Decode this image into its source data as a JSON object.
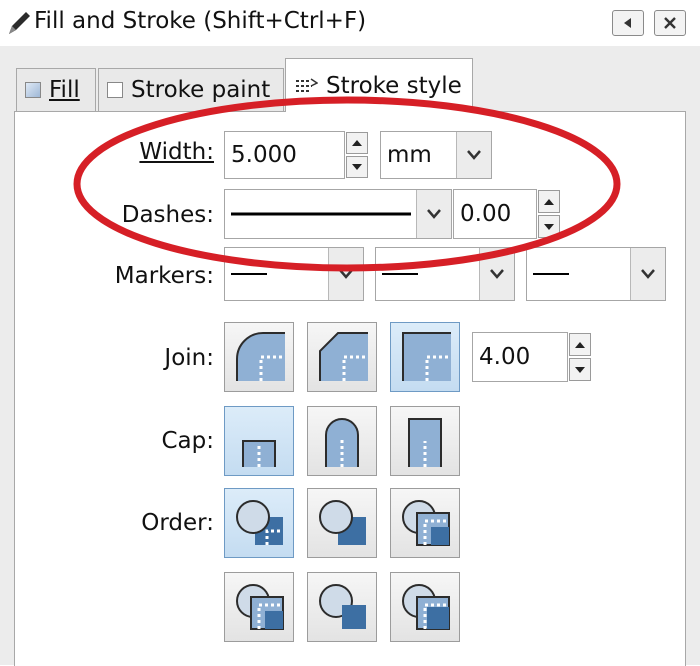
{
  "window": {
    "title": "Fill and Stroke (Shift+Ctrl+F)",
    "icons": [
      "pen-icon",
      "undock-icon",
      "close-icon"
    ]
  },
  "tabs": [
    {
      "label": "Fill",
      "active": false
    },
    {
      "label": "Stroke paint",
      "active": false
    },
    {
      "label": "Stroke style",
      "active": true
    }
  ],
  "width": {
    "label": "Width:",
    "value": "5.000",
    "unit": "mm"
  },
  "dashes": {
    "label": "Dashes:",
    "offset": "0.00"
  },
  "markers": {
    "label": "Markers:"
  },
  "join": {
    "label": "Join:",
    "miter_limit": "4.00",
    "selected": "miter"
  },
  "cap": {
    "label": "Cap:",
    "selected": "butt"
  },
  "order": {
    "label": "Order:",
    "selected": 0
  },
  "colors": {
    "annotation": "#d61f26",
    "selected": "#c7dff3",
    "shape": "#3d6fa3"
  }
}
